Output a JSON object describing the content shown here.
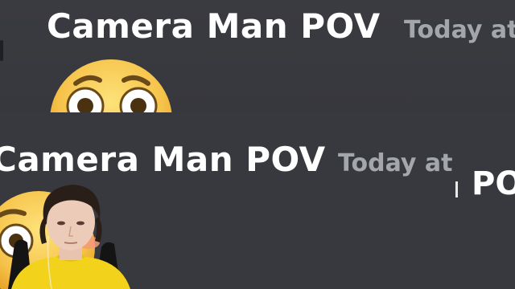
{
  "messages": [
    {
      "author": "Camera Man POV",
      "timestamp": "Today at",
      "emoji": "flushed-face-emoji"
    },
    {
      "author": "Camera Man POV",
      "timestamp": "Today at",
      "emoji": "flushed-face-emoji"
    }
  ],
  "overflow_fragment": "PO",
  "colors": {
    "background": "#36393f",
    "author_text": "#ffffff",
    "timestamp_text": "#a3a6aa",
    "emoji_yellow": "#f6c34a",
    "streamer_shirt": "#f2d21a"
  },
  "overlay": {
    "type": "streamer-webcam"
  }
}
